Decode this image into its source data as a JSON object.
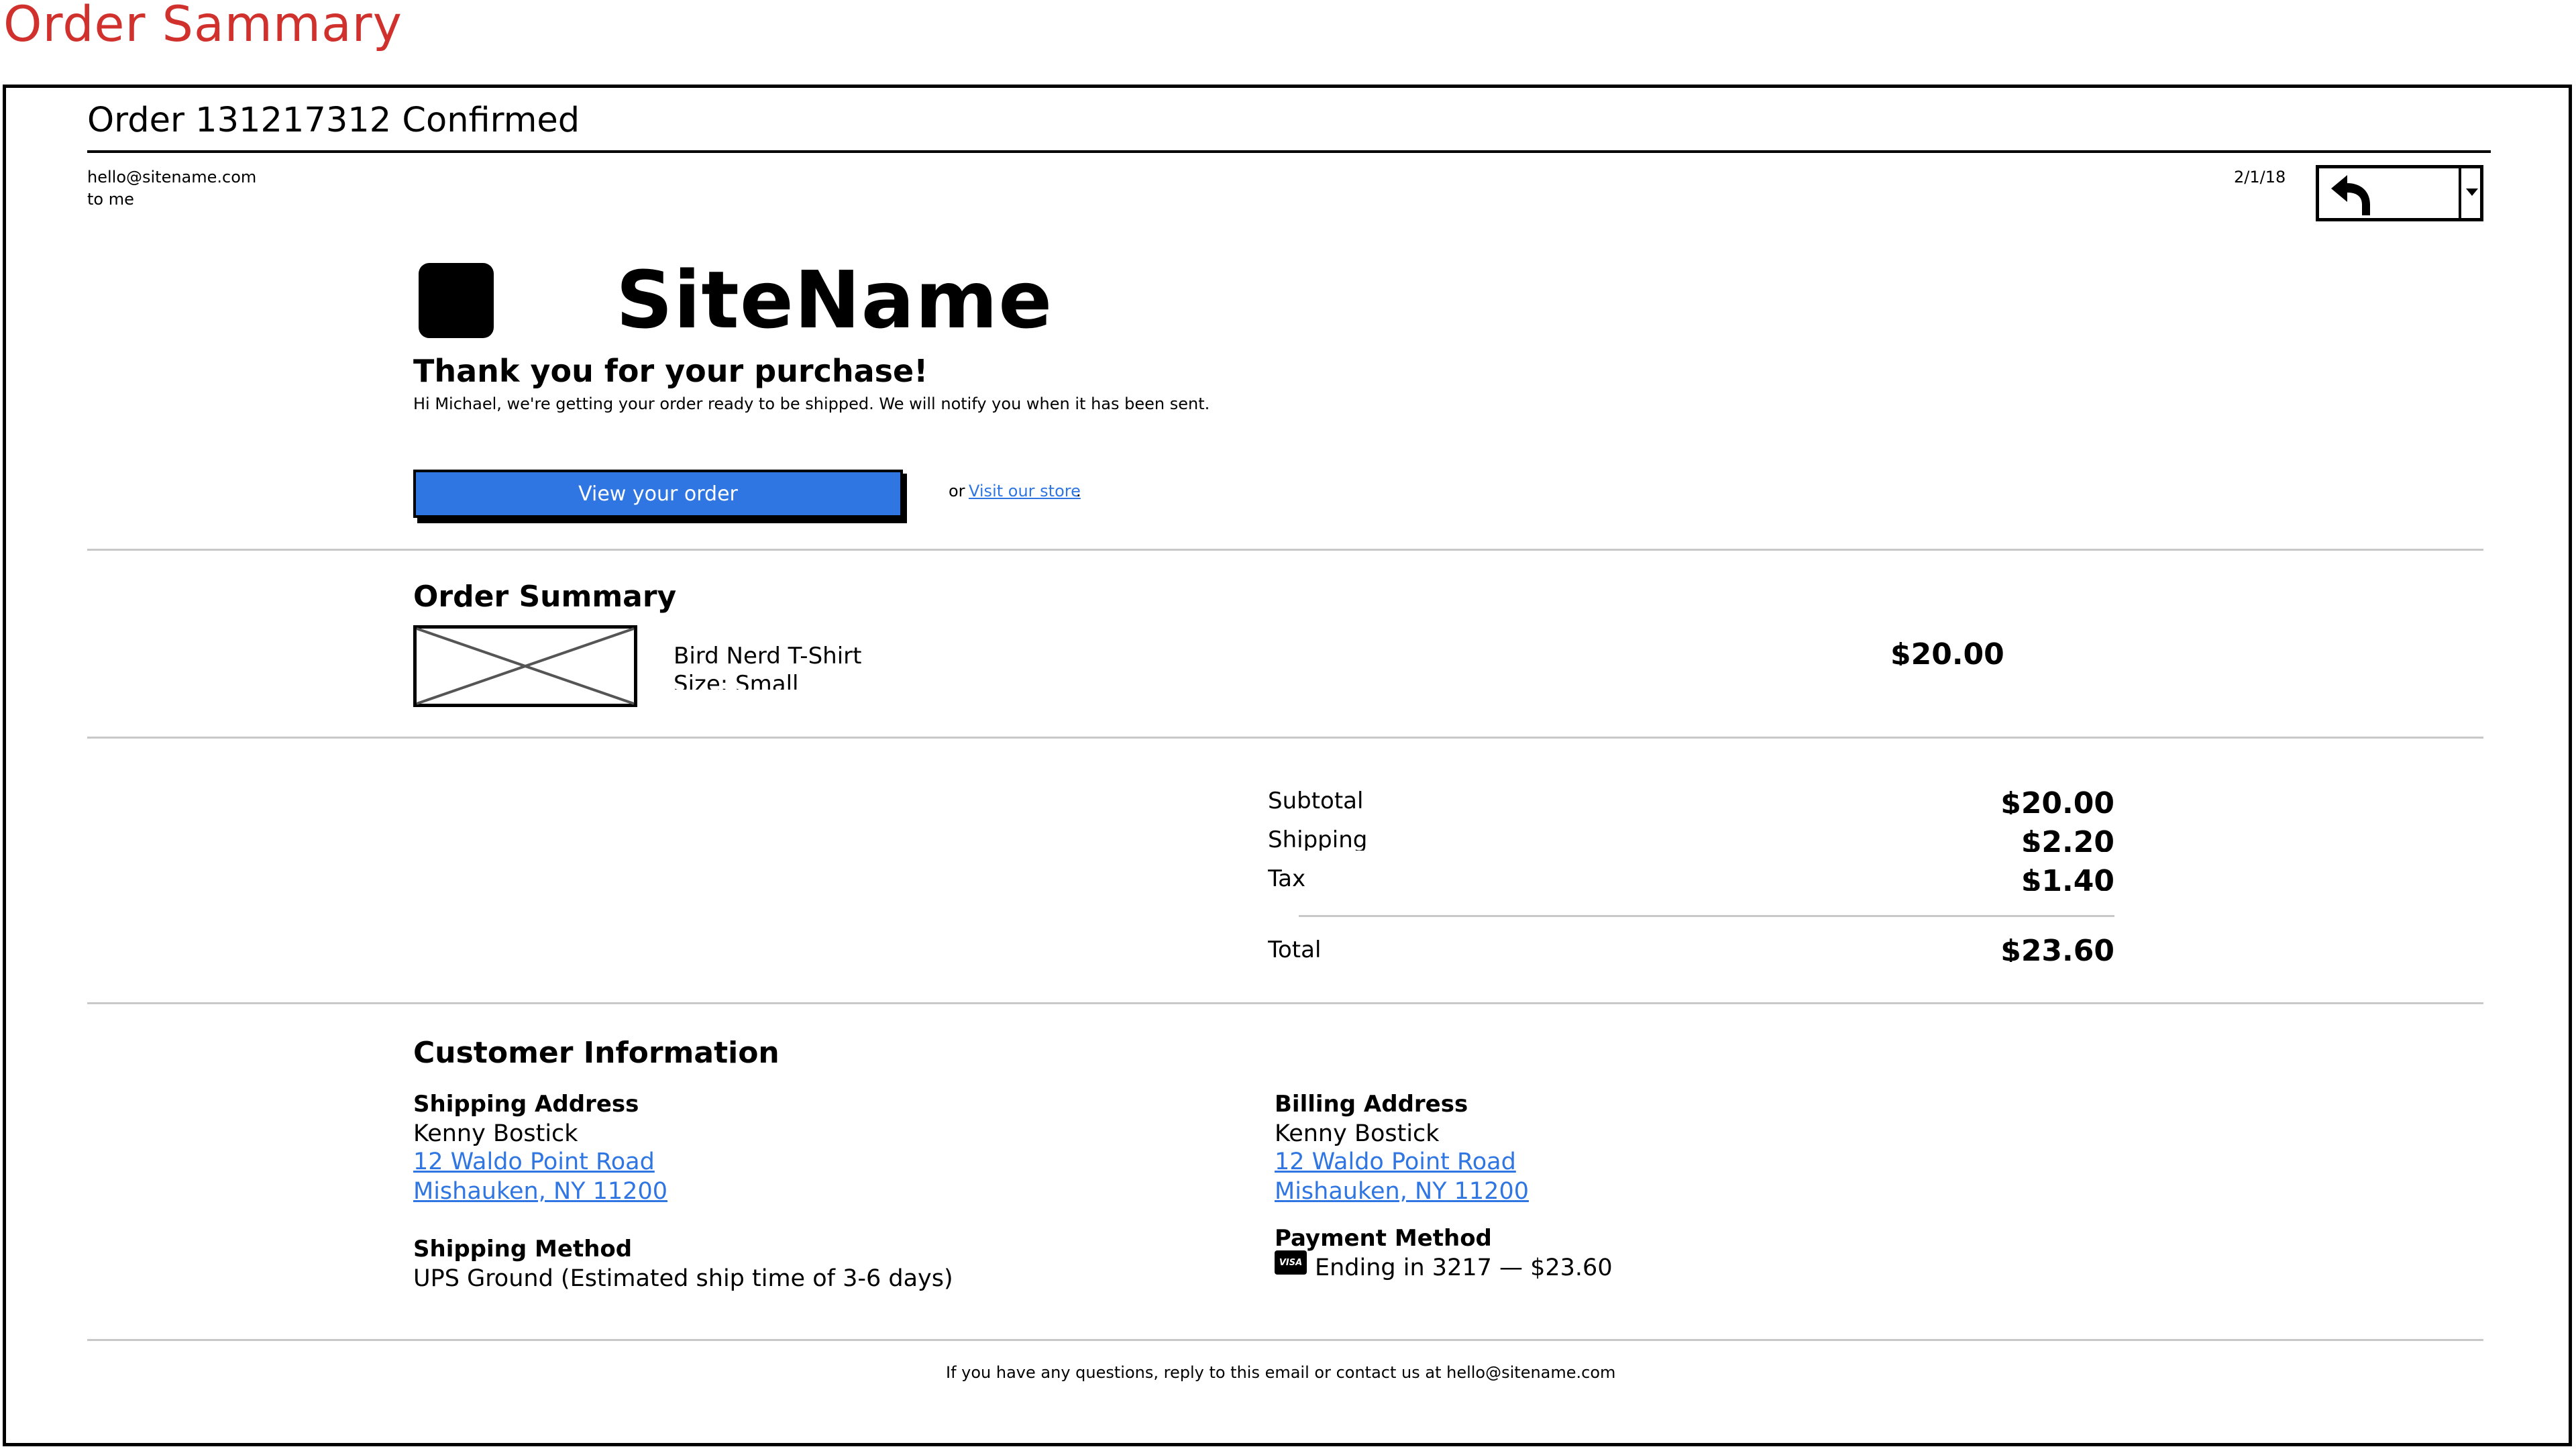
{
  "page": {
    "title": "Order Sammary"
  },
  "email": {
    "subject": "Order 131217312 Confirmed",
    "from": "hello@sitename.com",
    "to": "to me",
    "date": "2/1/18"
  },
  "toolbar": {
    "reply_icon": "reply-arrow-icon",
    "dropdown_icon": "caret-down-icon"
  },
  "brand": {
    "name": "SiteName",
    "logo_icon": "logo-square-icon"
  },
  "message": {
    "heading": "Thank you for your purchase!",
    "body": "Hi Michael, we're getting your order ready to be shipped. We will notify you when it has been sent.",
    "view_order_label": "View your order",
    "or_text": "or",
    "visit_store_label": "Visit our store",
    "period": "."
  },
  "order_summary": {
    "heading": "Order Summary",
    "items": [
      {
        "name": "Bird Nerd T-Shirt",
        "size": "Size: Small",
        "price": "$20.00",
        "image_icon": "image-placeholder-icon"
      }
    ],
    "totals": [
      {
        "label": "Subtotal",
        "value": "$20.00"
      },
      {
        "label": "Shipping",
        "value": "$2.20"
      },
      {
        "label": "Tax",
        "value": "$1.40"
      }
    ],
    "total": {
      "label": "Total",
      "value": "$23.60"
    }
  },
  "customer": {
    "heading": "Customer Information",
    "shipping_address": {
      "heading": "Shipping Address",
      "name": "Kenny Bostick",
      "line1": "12 Waldo Point Road",
      "line2": "Mishauken, NY 11200"
    },
    "shipping_method": {
      "heading": "Shipping Method",
      "value": "UPS Ground (Estimated ship time of 3-6 days)"
    },
    "billing_address": {
      "heading": "Billing Address",
      "name": "Kenny Bostick",
      "line1": "12 Waldo Point Road",
      "line2": "Mishauken, NY 11200"
    },
    "payment_method": {
      "heading": "Payment Method",
      "card_brand": "VISA",
      "value": "Ending in 3217 — $23.60"
    }
  },
  "footer": {
    "text": "If you have any questions, reply to this email or contact us at hello@sitename.com"
  },
  "colors": {
    "accent": "#2f76e3",
    "title_red": "#d0312d",
    "rule": "#c8c8c8"
  }
}
